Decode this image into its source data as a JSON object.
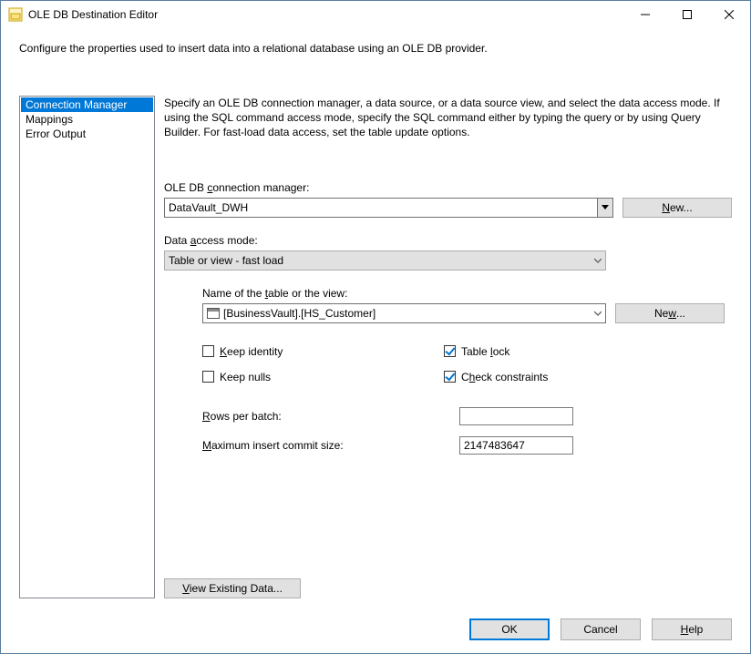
{
  "window": {
    "title": "OLE DB Destination Editor"
  },
  "description": "Configure the properties used to insert data into a relational database using an OLE DB provider.",
  "sidebar": {
    "items": [
      {
        "label": "Connection Manager",
        "selected": true
      },
      {
        "label": "Mappings",
        "selected": false
      },
      {
        "label": "Error Output",
        "selected": false
      }
    ]
  },
  "help_text": "Specify an OLE DB connection manager, a data source, or a data source view, and select the data access mode. If using the SQL command access mode, specify the SQL command either by typing the query or by using Query Builder. For fast-load data access, set the table update options.",
  "fields": {
    "conn_label_pre": "OLE DB ",
    "conn_label_u": "c",
    "conn_label_post": "onnection manager:",
    "conn_value": "DataVault_DWH",
    "new_conn": "New...",
    "mode_label_pre": "Data ",
    "mode_label_u": "a",
    "mode_label_post": "ccess mode:",
    "mode_value": "Table or view - fast load",
    "table_label_pre": "Name of the ",
    "table_label_u": "t",
    "table_label_post": "able or the view:",
    "table_value": "[BusinessVault].[HS_Customer]",
    "new_table_pre": "Ne",
    "new_table_u": "w",
    "new_table_post": "...",
    "keep_identity_pre": "",
    "keep_identity_u": "K",
    "keep_identity_post": "eep identity",
    "keep_identity_checked": false,
    "table_lock_pre": "Table ",
    "table_lock_u": "l",
    "table_lock_post": "ock",
    "table_lock_checked": true,
    "keep_nulls_label": "Keep nulls",
    "keep_nulls_checked": false,
    "check_constraints_pre": "C",
    "check_constraints_u": "h",
    "check_constraints_post": "eck constraints",
    "check_constraints_checked": true,
    "rows_label_pre": "",
    "rows_label_u": "R",
    "rows_label_post": "ows per batch:",
    "rows_value": "",
    "commit_label_pre": "",
    "commit_label_u": "M",
    "commit_label_post": "aximum insert commit size:",
    "commit_value": "2147483647",
    "view_data_pre": "",
    "view_data_u": "V",
    "view_data_post": "iew Existing Data..."
  },
  "buttons": {
    "ok": "OK",
    "cancel": "Cancel",
    "help_u": "H",
    "help_post": "elp"
  }
}
